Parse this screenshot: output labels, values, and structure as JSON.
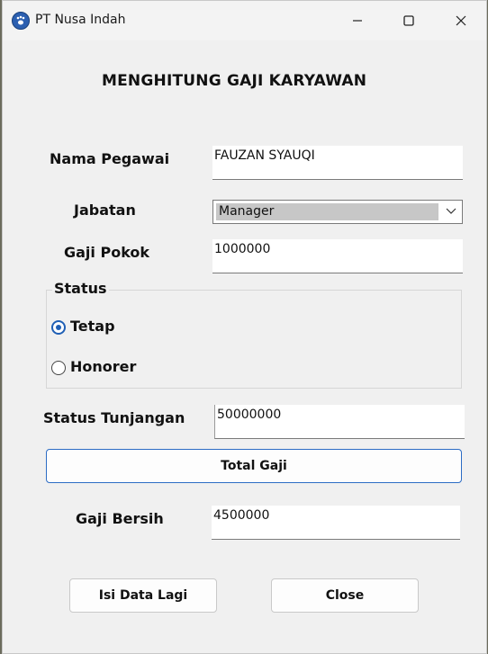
{
  "window": {
    "title": "PT Nusa Indah",
    "icon": "paw-icon"
  },
  "form": {
    "heading": "MENGHITUNG GAJI KARYAWAN",
    "nama_label": "Nama Pegawai",
    "nama_value": "FAUZAN SYAUQI",
    "jabatan_label": "Jabatan",
    "jabatan_value": "Manager",
    "gaji_pokok_label": "Gaji Pokok",
    "gaji_pokok_value": "1000000",
    "status_group_title": "Status",
    "status_options": [
      {
        "label": "Tetap",
        "checked": true
      },
      {
        "label": "Honorer",
        "checked": false
      }
    ],
    "tunjangan_label": "Status Tunjangan",
    "tunjangan_value": "50000000",
    "total_button": "Total Gaji",
    "bersih_label": "Gaji Bersih",
    "bersih_value": "4500000",
    "isi_button": "Isi Data Lagi",
    "close_button": "Close"
  },
  "colors": {
    "accent": "#1f5fb5",
    "background": "#f0f0f0"
  }
}
